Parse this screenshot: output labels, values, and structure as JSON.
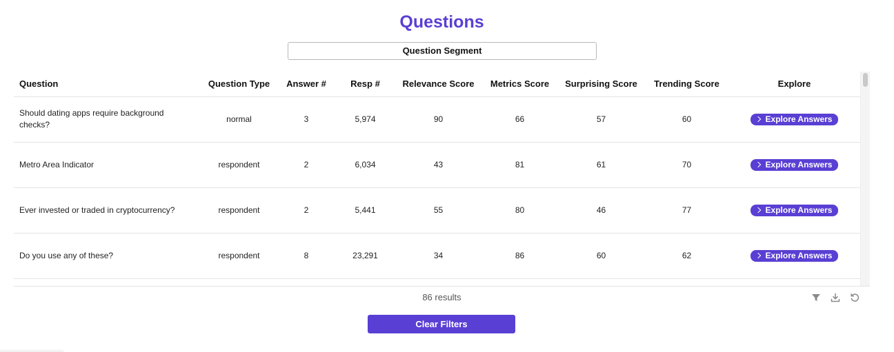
{
  "page": {
    "title": "Questions",
    "segment_label": "Question Segment"
  },
  "table": {
    "columns": {
      "question": "Question",
      "question_type": "Question Type",
      "answer_count": "Answer #",
      "resp_count": "Resp #",
      "relevance": "Relevance Score",
      "metrics": "Metrics Score",
      "surprising": "Surprising Score",
      "trending": "Trending Score",
      "explore": "Explore"
    },
    "rows": [
      {
        "question": "Should dating apps require background checks?",
        "question_type": "normal",
        "answer_count": "3",
        "resp_count": "5,974",
        "relevance": "90",
        "metrics": "66",
        "surprising": "57",
        "trending": "60",
        "explore_label": "Explore Answers"
      },
      {
        "question": "Metro Area Indicator",
        "question_type": "respondent",
        "answer_count": "2",
        "resp_count": "6,034",
        "relevance": "43",
        "metrics": "81",
        "surprising": "61",
        "trending": "70",
        "explore_label": "Explore Answers"
      },
      {
        "question": "Ever invested or traded in cryptocurrency?",
        "question_type": "respondent",
        "answer_count": "2",
        "resp_count": "5,441",
        "relevance": "55",
        "metrics": "80",
        "surprising": "46",
        "trending": "77",
        "explore_label": "Explore Answers"
      },
      {
        "question": "Do you use any of these?",
        "question_type": "respondent",
        "answer_count": "8",
        "resp_count": "23,291",
        "relevance": "34",
        "metrics": "86",
        "surprising": "60",
        "trending": "62",
        "explore_label": "Explore Answers"
      }
    ]
  },
  "footer": {
    "results_text": "86 results",
    "clear_filters_label": "Clear Filters",
    "icons": [
      "filter-icon",
      "download-icon",
      "reset-icon"
    ]
  },
  "theme": {
    "accent": "#5a3fd4"
  }
}
